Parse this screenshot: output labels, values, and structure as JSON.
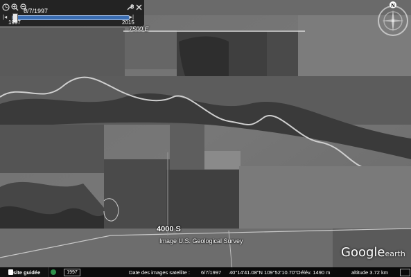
{
  "time_slider": {
    "date": "6/7/1997",
    "start_year": "1997",
    "end_year": "2015",
    "position_fraction": 0.0
  },
  "compass": {
    "north_label": "N"
  },
  "map": {
    "road_top_label": "7500 E",
    "road_bottom_label": "4000 S",
    "imagery_credit": "Image U.S. Geological Survey"
  },
  "logo": {
    "google": "Google",
    "earth": "earth"
  },
  "status_bar": {
    "guided_tour": "Visite guidée",
    "year_field": "1997",
    "imagery_date_label": "Date des images satellite : ",
    "imagery_date": "6/7/1997",
    "coordinates": "40°14'41.08\"N 109°52'10.70\"O",
    "elevation": "élév. 1490 m",
    "altitude": "altitude 3.72 km"
  },
  "icons": [
    "clock-icon",
    "zoom-in-icon",
    "zoom-out-icon",
    "wrench-icon",
    "close-icon",
    "compass-rose-icon",
    "tour-icon"
  ]
}
